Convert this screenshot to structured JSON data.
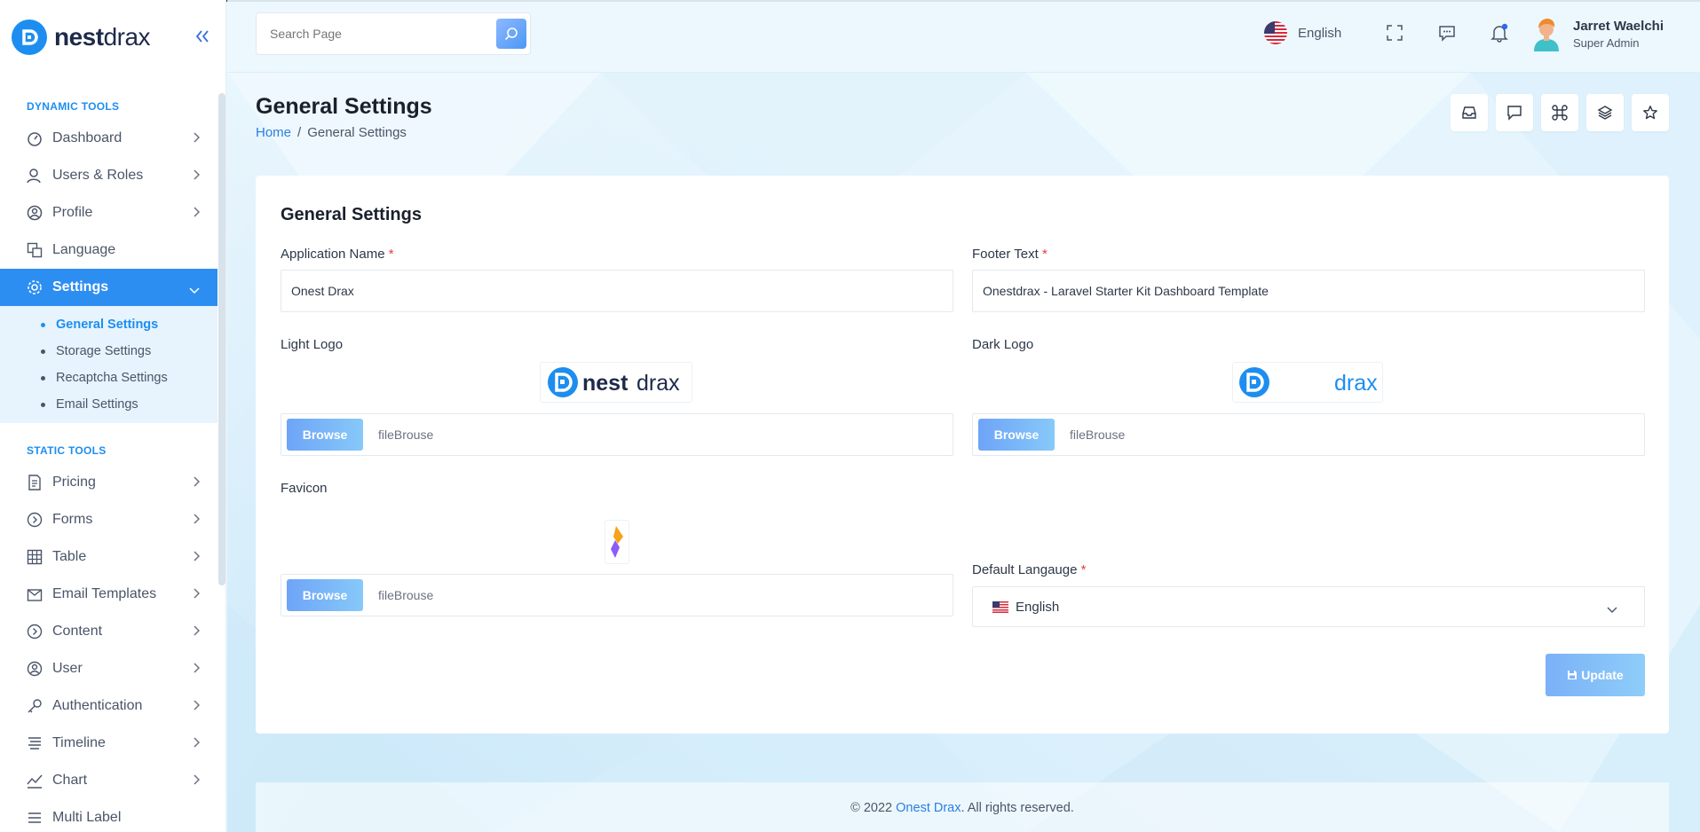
{
  "brand": {
    "name_bold": "nest",
    "name_light": "drax"
  },
  "header": {
    "search_placeholder": "Search Page",
    "language": "English",
    "user_name": "Jarret Waelchi",
    "user_role": "Super Admin"
  },
  "sidebar": {
    "dynamic_title": "DYNAMIC TOOLS",
    "dynamic_items": [
      {
        "label": "Dashboard",
        "icon": "dashboard-icon"
      },
      {
        "label": "Users & Roles",
        "icon": "user-icon"
      },
      {
        "label": "Profile",
        "icon": "profile-icon"
      },
      {
        "label": "Language",
        "icon": "language-icon"
      },
      {
        "label": "Settings",
        "icon": "gear-icon",
        "active": true
      }
    ],
    "settings_sub": [
      {
        "label": "General Settings",
        "active": true
      },
      {
        "label": "Storage Settings"
      },
      {
        "label": "Recaptcha Settings"
      },
      {
        "label": "Email Settings"
      }
    ],
    "static_title": "STATIC TOOLS",
    "static_items": [
      {
        "label": "Pricing",
        "icon": "pricing-icon"
      },
      {
        "label": "Forms",
        "icon": "forms-icon"
      },
      {
        "label": "Table",
        "icon": "table-icon"
      },
      {
        "label": "Email Templates",
        "icon": "mail-icon"
      },
      {
        "label": "Content",
        "icon": "content-icon"
      },
      {
        "label": "User",
        "icon": "user-circle-icon"
      },
      {
        "label": "Authentication",
        "icon": "key-icon"
      },
      {
        "label": "Timeline",
        "icon": "timeline-icon"
      },
      {
        "label": "Chart",
        "icon": "chart-icon"
      },
      {
        "label": "Multi Label",
        "icon": "multi-label-icon"
      }
    ]
  },
  "page": {
    "title": "General Settings",
    "breadcrumb_home": "Home",
    "breadcrumb_sep": "/",
    "breadcrumb_current": "General Settings"
  },
  "form": {
    "card_title": "General Settings",
    "app_name_label": "Application Name",
    "app_name_value": "Onest Drax",
    "footer_text_label": "Footer Text",
    "footer_text_value": "Onestdrax - Laravel Starter Kit Dashboard Template",
    "light_logo_label": "Light Logo",
    "dark_logo_label": "Dark Logo",
    "favicon_label": "Favicon",
    "browse_label": "Browse",
    "file_placeholder": "fileBrouse",
    "required_mark": "*",
    "default_language_label": "Default Langauge",
    "default_language_value": "English",
    "dark_logo_text": "drax",
    "update_label": "Update"
  },
  "footer": {
    "prefix": "© 2022 ",
    "brand": "Onest Drax",
    "suffix": ". All rights reserved."
  },
  "colors": {
    "accent": "#2d8ef2",
    "link": "#2b7fe0",
    "required": "#e53e3e"
  }
}
